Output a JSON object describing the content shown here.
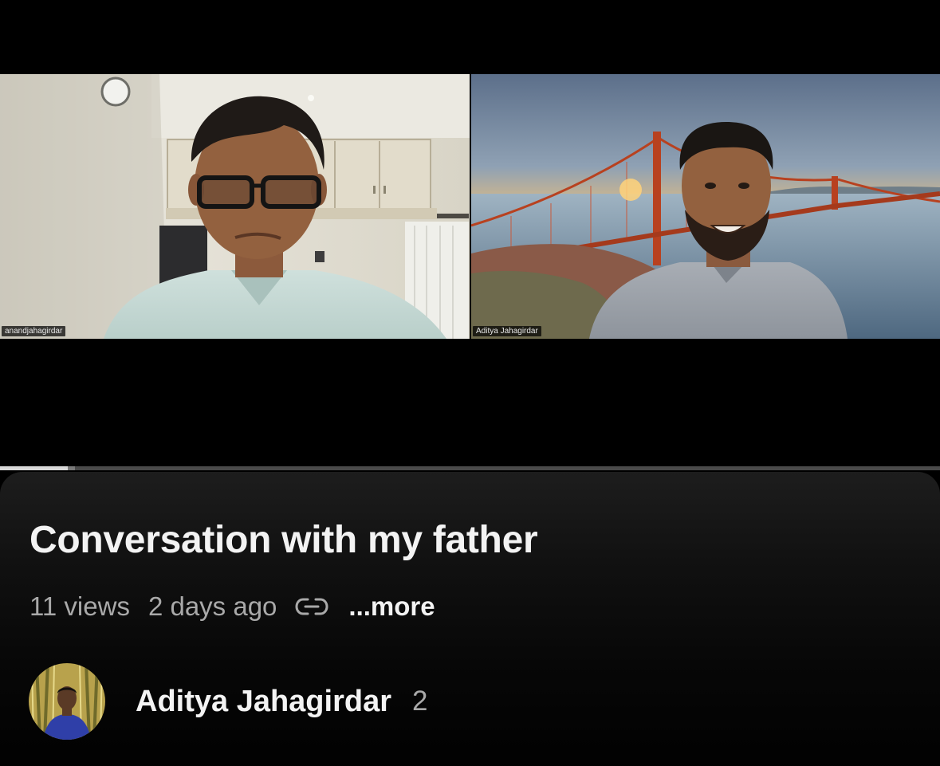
{
  "player": {
    "participants": [
      {
        "name": "anandjahagirdar"
      },
      {
        "name": "Aditya Jahagirdar"
      }
    ],
    "progress": {
      "played_fraction": 0.072,
      "buffered_fraction": 0.08
    }
  },
  "video": {
    "title": "Conversation with my father",
    "views": "11 views",
    "posted": "2 days ago",
    "link_icon": "link-icon",
    "more_label": "...more"
  },
  "channel": {
    "name": "Aditya Jahagirdar",
    "subscriber_count": "2",
    "avatar_icon": "avatar"
  },
  "colors": {
    "background": "#000000",
    "title_text": "#f3f3f3",
    "secondary_text": "#a9a9a9",
    "progress_track": "#4a4a4a",
    "progress_fill": "#d8d8d8"
  }
}
